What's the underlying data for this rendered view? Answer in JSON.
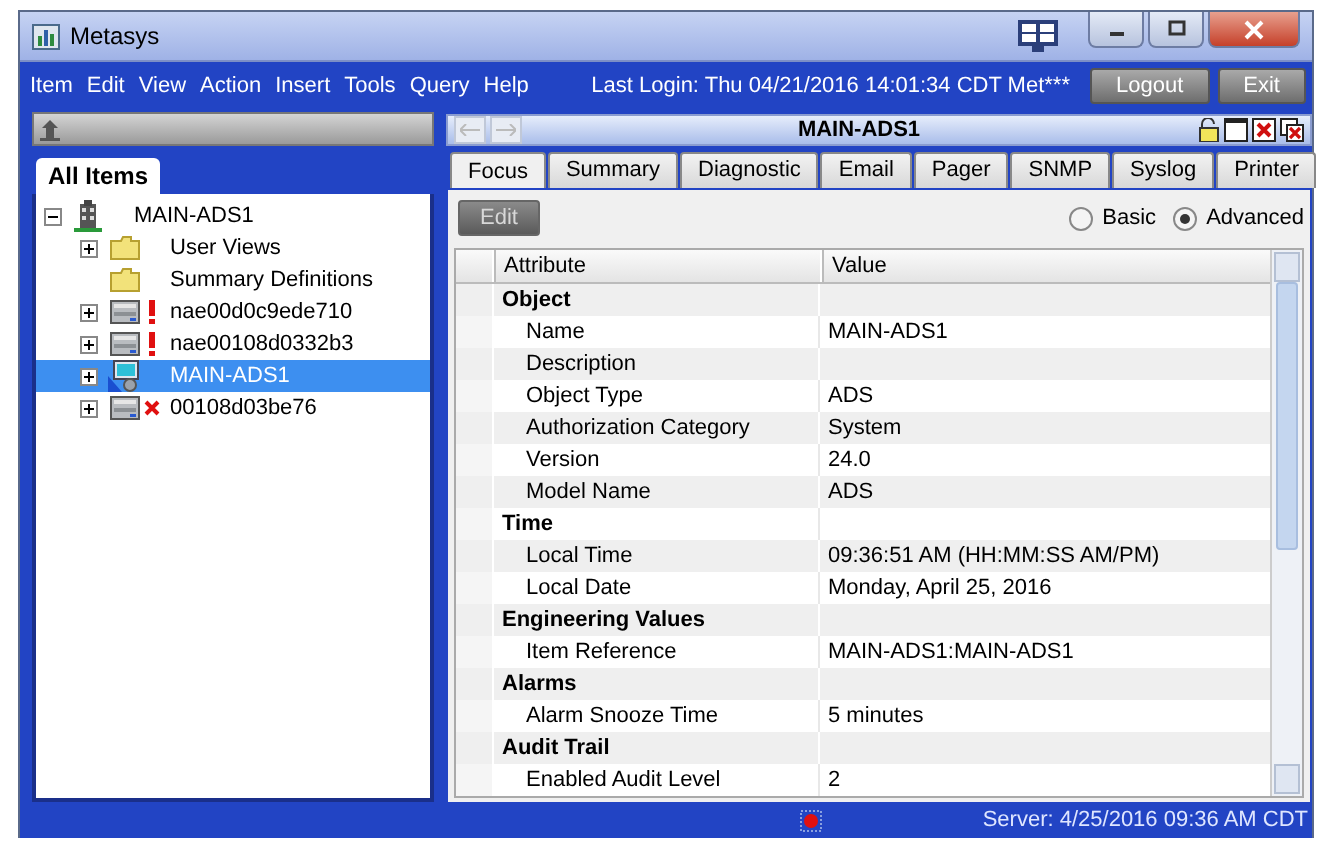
{
  "window": {
    "title": "Metasys"
  },
  "menu": [
    {
      "label": "Item"
    },
    {
      "label": "Edit"
    },
    {
      "label": "View"
    },
    {
      "label": "Action"
    },
    {
      "label": "Insert"
    },
    {
      "label": "Tools"
    },
    {
      "label": "Query"
    },
    {
      "label": "Help"
    }
  ],
  "last_login": "Last Login: Thu 04/21/2016 14:01:34 CDT Met***",
  "header_buttons": [
    "Logout",
    "Exit"
  ],
  "navigator": {
    "tab": "All Items",
    "tree": [
      {
        "label": "MAIN-ADS1",
        "kind": "building",
        "expanded": true,
        "selected": false,
        "children": [
          {
            "label": "User Views",
            "kind": "folder",
            "expanded": false,
            "alarm": false,
            "offline": false,
            "selected": false
          },
          {
            "label": "Summary Definitions",
            "kind": "folder",
            "alarm": false,
            "offline": false,
            "selected": false
          },
          {
            "label": "nae00d0c9ede710",
            "kind": "device",
            "alarm": true,
            "offline": false,
            "expanded": false,
            "selected": false
          },
          {
            "label": "nae00108d0332b3",
            "kind": "device",
            "alarm": true,
            "offline": false,
            "expanded": false,
            "selected": false
          },
          {
            "label": "MAIN-ADS1",
            "kind": "server",
            "expanded": false,
            "alarm": false,
            "offline": false,
            "selected": true
          },
          {
            "label": "00108d03be76",
            "kind": "device",
            "alarm": false,
            "offline": true,
            "expanded": false,
            "selected": false
          }
        ]
      }
    ]
  },
  "detail": {
    "title": "MAIN-ADS1",
    "tabs": [
      {
        "label": "Focus",
        "selected": true
      },
      {
        "label": "Summary",
        "selected": false
      },
      {
        "label": "Diagnostic",
        "selected": false
      },
      {
        "label": "Email",
        "selected": false
      },
      {
        "label": "Pager",
        "selected": false
      },
      {
        "label": "SNMP",
        "selected": false
      },
      {
        "label": "Syslog",
        "selected": false
      },
      {
        "label": "Printer",
        "selected": false
      }
    ],
    "edit_button": {
      "label": "Edit",
      "disabled": true
    },
    "view_modes": [
      {
        "label": "Basic",
        "selected": false
      },
      {
        "label": "Advanced",
        "selected": true
      }
    ],
    "table": {
      "columns": [
        "Attribute",
        "Value"
      ],
      "rows": [
        {
          "kind": "group",
          "attribute": "Object"
        },
        {
          "kind": "attribute",
          "attribute": "Name",
          "value": "MAIN-ADS1"
        },
        {
          "kind": "attribute",
          "attribute": "Description"
        },
        {
          "kind": "attribute",
          "attribute": "Object Type",
          "value": "ADS"
        },
        {
          "kind": "attribute",
          "attribute": "Authorization Category",
          "value": "System"
        },
        {
          "kind": "attribute",
          "attribute": "Version",
          "value": "24.0"
        },
        {
          "kind": "attribute",
          "attribute": "Model Name",
          "value": "ADS"
        },
        {
          "kind": "group",
          "attribute": "Time"
        },
        {
          "kind": "attribute",
          "attribute": "Local Time",
          "value": "09:36:51 AM (HH:MM:SS AM/PM)"
        },
        {
          "kind": "attribute",
          "attribute": "Local Date",
          "value": "Monday, April 25, 2016"
        },
        {
          "kind": "group",
          "attribute": "Engineering Values"
        },
        {
          "kind": "attribute",
          "attribute": "Item Reference",
          "value": "MAIN-ADS1:MAIN-ADS1"
        },
        {
          "kind": "group",
          "attribute": "Alarms"
        },
        {
          "kind": "attribute",
          "attribute": "Alarm Snooze Time",
          "value": "5 minutes"
        },
        {
          "kind": "group",
          "attribute": "Audit Trail"
        },
        {
          "kind": "attribute",
          "attribute": "Enabled Audit Level",
          "value": "2"
        }
      ]
    }
  },
  "status_bar": {
    "server_time": "Server: 4/25/2016 09:36 AM CDT"
  }
}
